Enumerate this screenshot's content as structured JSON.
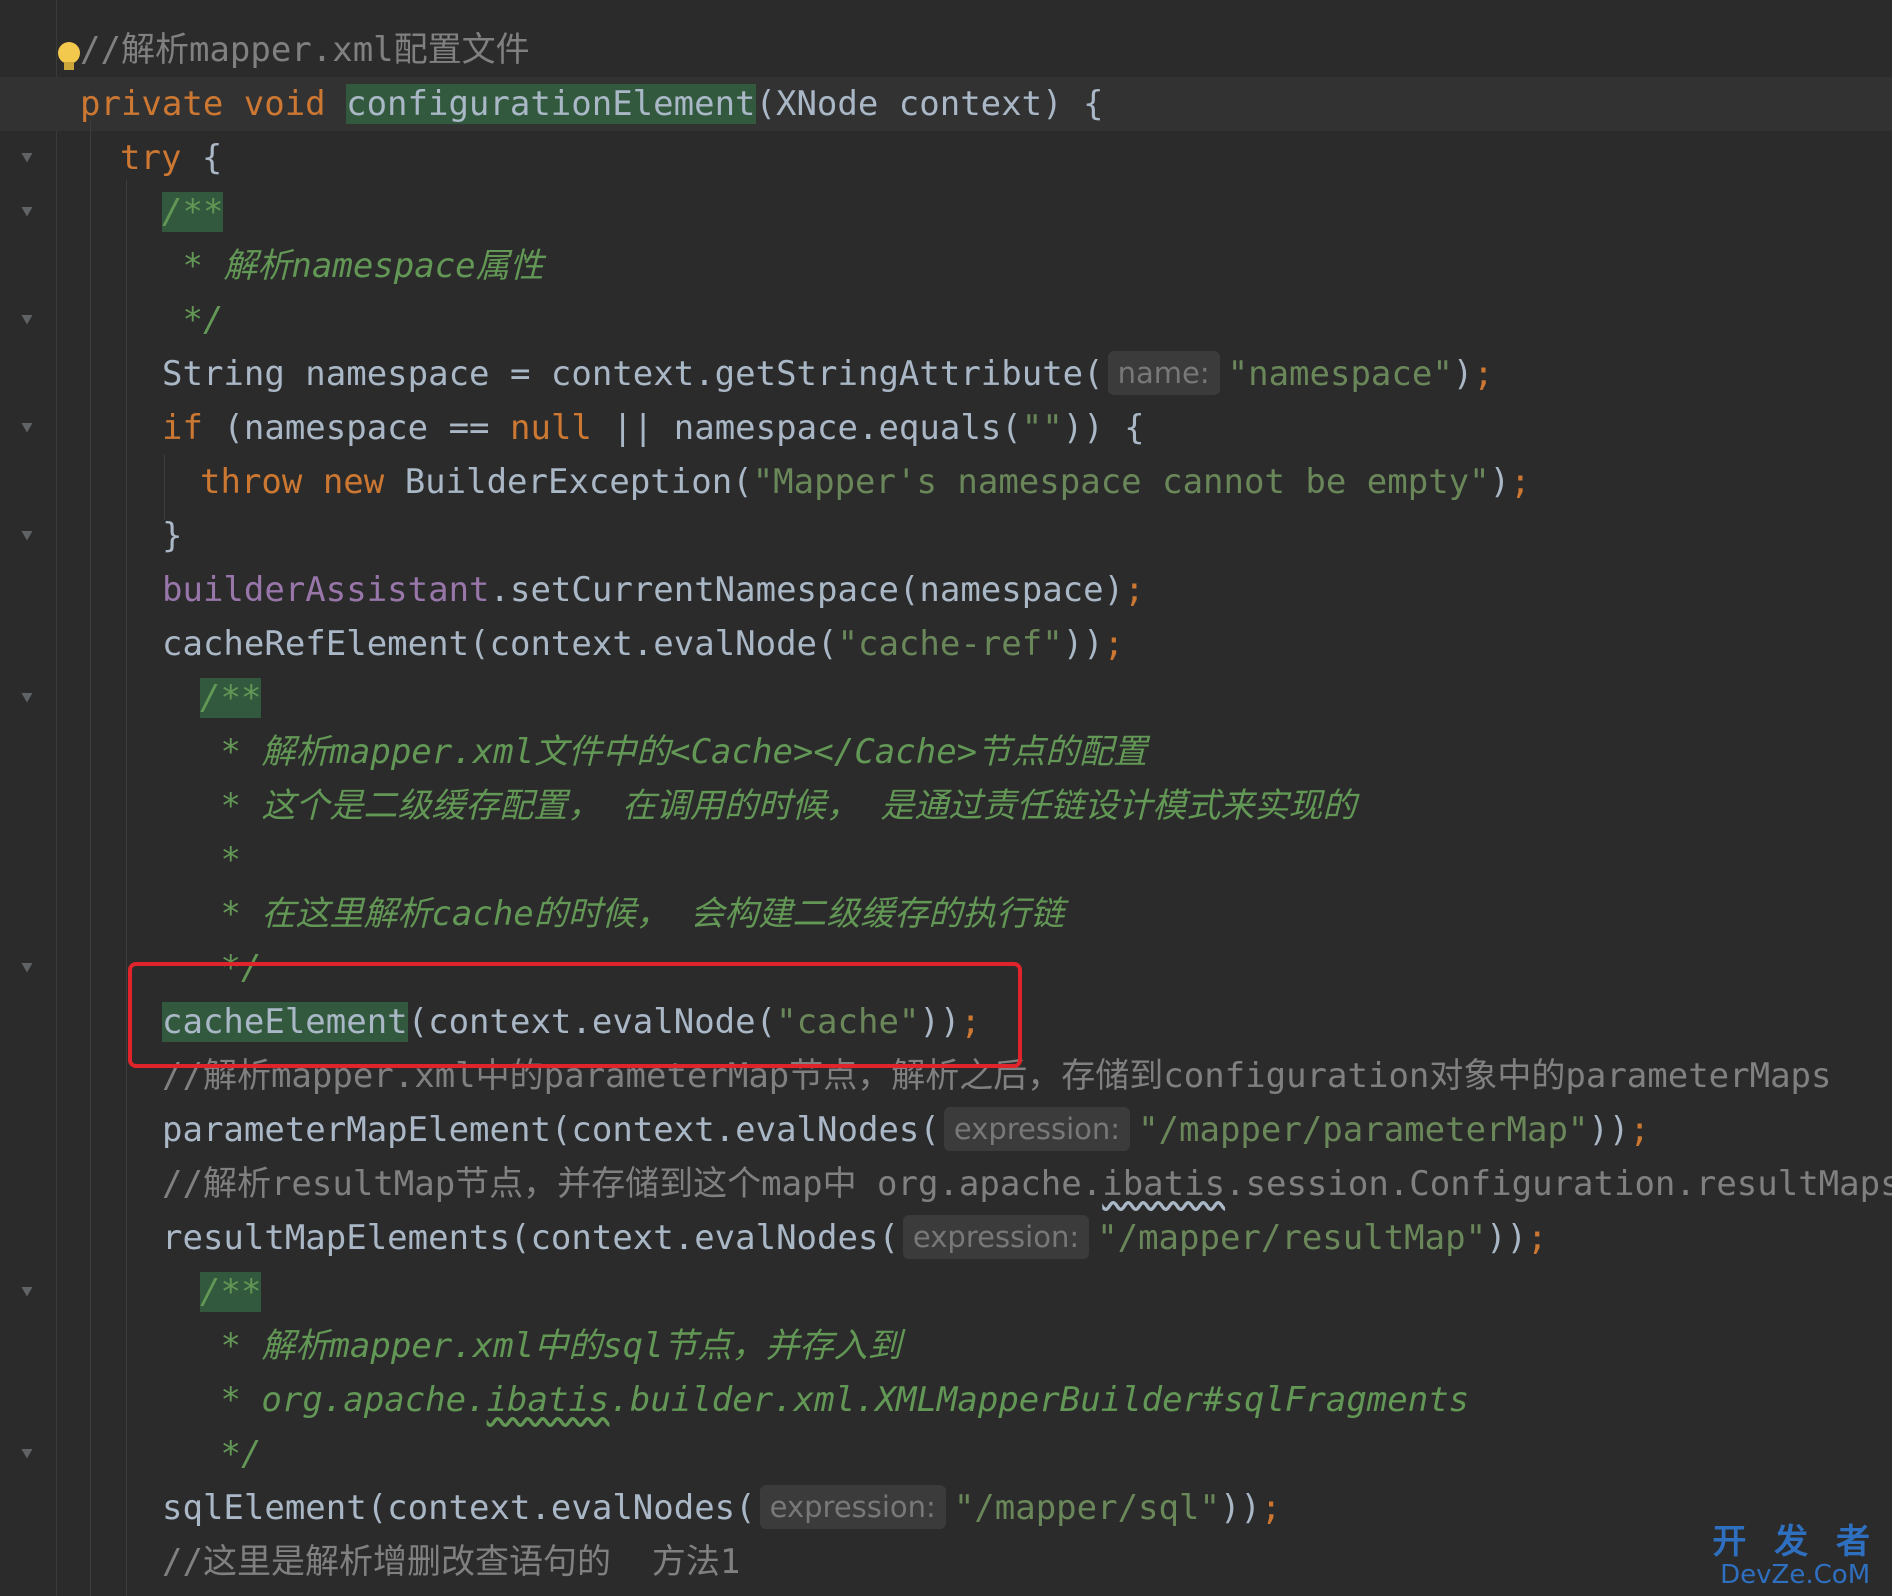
{
  "editor": {
    "code_lines": [
      {
        "tokens": [
          {
            "t": "//解析mapper.xml配置文件",
            "c": "cmt"
          }
        ]
      },
      {
        "tokens": [
          {
            "t": "private void ",
            "c": "kw"
          },
          {
            "t": "configurationElement",
            "c": "hl"
          },
          {
            "t": "(XNode context) {",
            "c": "plain"
          }
        ]
      },
      {
        "tokens": [
          {
            "t": "try ",
            "c": "kw"
          },
          {
            "t": "{",
            "c": "plain"
          }
        ]
      },
      {
        "tokens": [
          {
            "t": "/**",
            "c": "doc hl"
          }
        ]
      },
      {
        "tokens": [
          {
            "t": " * 解析namespace属性",
            "c": "doc"
          }
        ]
      },
      {
        "tokens": [
          {
            "t": " */",
            "c": "doc"
          }
        ]
      },
      {
        "tokens": [
          {
            "t": "String namespace = context.getStringAttribute(",
            "c": "plain"
          },
          {
            "t": "name:",
            "c": "hint"
          },
          {
            "t": "\"namespace\"",
            "c": "str"
          },
          {
            "t": ")",
            "c": "plain"
          },
          {
            "t": ";",
            "c": "kw"
          }
        ]
      },
      {
        "tokens": [
          {
            "t": "if ",
            "c": "kw"
          },
          {
            "t": "(namespace == ",
            "c": "plain"
          },
          {
            "t": "null ",
            "c": "kw"
          },
          {
            "t": "|| namespace.equals(",
            "c": "plain"
          },
          {
            "t": "\"\"",
            "c": "str"
          },
          {
            "t": ")) {",
            "c": "plain"
          }
        ]
      },
      {
        "tokens": [
          {
            "t": "throw new ",
            "c": "kw"
          },
          {
            "t": "BuilderException(",
            "c": "plain"
          },
          {
            "t": "\"Mapper's namespace cannot be empty\"",
            "c": "str"
          },
          {
            "t": ")",
            "c": "plain"
          },
          {
            "t": ";",
            "c": "kw"
          }
        ]
      },
      {
        "tokens": [
          {
            "t": "}",
            "c": "plain"
          }
        ]
      },
      {
        "tokens": [
          {
            "t": "builderAssistant",
            "c": "field"
          },
          {
            "t": ".setCurrentNamespace(namespace)",
            "c": "plain"
          },
          {
            "t": ";",
            "c": "kw"
          }
        ]
      },
      {
        "tokens": [
          {
            "t": "cacheRefElement(context.evalNode(",
            "c": "plain"
          },
          {
            "t": "\"cache-ref\"",
            "c": "str"
          },
          {
            "t": "))",
            "c": "plain"
          },
          {
            "t": ";",
            "c": "kw"
          }
        ]
      },
      {
        "tokens": [
          {
            "t": "/**",
            "c": "doc hl"
          }
        ]
      },
      {
        "tokens": [
          {
            "t": " * 解析mapper.xml文件中的<Cache></Cache>节点的配置",
            "c": "doc"
          }
        ]
      },
      {
        "tokens": [
          {
            "t": " * 这个是二级缓存配置， 在调用的时候， 是通过责任链设计模式来实现的",
            "c": "doc"
          }
        ]
      },
      {
        "tokens": [
          {
            "t": " *",
            "c": "doc"
          }
        ]
      },
      {
        "tokens": [
          {
            "t": " * 在这里解析cache的时候， 会构建二级缓存的执行链",
            "c": "doc"
          }
        ]
      },
      {
        "tokens": [
          {
            "t": " */",
            "c": "doc"
          }
        ]
      },
      {
        "tokens": [
          {
            "t": "cacheElement",
            "c": "hl"
          },
          {
            "t": "(context.evalNode(",
            "c": "plain"
          },
          {
            "t": "\"cache\"",
            "c": "str"
          },
          {
            "t": "))",
            "c": "plain"
          },
          {
            "t": ";",
            "c": "kw"
          }
        ]
      },
      {
        "tokens": [
          {
            "t": "//解析mapper.xml中的parameterMap节点，解析之后，存储到configuration对象中的parameterMaps",
            "c": "cmt"
          }
        ]
      },
      {
        "tokens": [
          {
            "t": "parameterMapElement(context.evalNodes(",
            "c": "plain"
          },
          {
            "t": "expression:",
            "c": "hint"
          },
          {
            "t": "\"/mapper/parameterMap\"",
            "c": "str"
          },
          {
            "t": "))",
            "c": "plain"
          },
          {
            "t": ";",
            "c": "kw"
          }
        ]
      },
      {
        "tokens": [
          {
            "t": "//解析resultMap节点，并存储到这个map中 org.apache.",
            "c": "cmt"
          },
          {
            "t": "ibatis",
            "c": "cmt squiggle-plain"
          },
          {
            "t": ".session.Configuration.resultMaps",
            "c": "cmt"
          }
        ]
      },
      {
        "tokens": [
          {
            "t": "resultMapElements(context.evalNodes(",
            "c": "plain"
          },
          {
            "t": "expression:",
            "c": "hint"
          },
          {
            "t": "\"/mapper/resultMap\"",
            "c": "str"
          },
          {
            "t": "))",
            "c": "plain"
          },
          {
            "t": ";",
            "c": "kw"
          }
        ]
      },
      {
        "tokens": [
          {
            "t": "/**",
            "c": "doc hl"
          }
        ]
      },
      {
        "tokens": [
          {
            "t": " * 解析mapper.xml中的sql节点，并存入到",
            "c": "doc"
          }
        ]
      },
      {
        "tokens": [
          {
            "t": " * org.apache.",
            "c": "doc"
          },
          {
            "t": "ibatis",
            "c": "doc squiggle"
          },
          {
            "t": ".builder.xml.XMLMapperBuilder#sqlFragments",
            "c": "doc"
          }
        ]
      },
      {
        "tokens": [
          {
            "t": " */",
            "c": "doc"
          }
        ]
      },
      {
        "tokens": [
          {
            "t": "sqlElement(context.evalNodes(",
            "c": "plain"
          },
          {
            "t": "expression:",
            "c": "hint"
          },
          {
            "t": "\"/mapper/sql\"",
            "c": "str"
          },
          {
            "t": "))",
            "c": "plain"
          },
          {
            "t": ";",
            "c": "kw"
          }
        ]
      },
      {
        "tokens": [
          {
            "t": "//这里是解析增删改查语句的  方法1",
            "c": "cmt"
          }
        ]
      }
    ]
  },
  "colors": {
    "background": "#2b2b2b",
    "keyword": "#cc7832",
    "string": "#6a8759",
    "doc_comment": "#629755",
    "line_comment": "#808080",
    "field": "#9876aa",
    "method_highlight_bg": "#32593d",
    "annotation_box": "#e0242b"
  },
  "icons": {
    "gutter_icon": "fold-marker-icon",
    "bulb_icon": "lightbulb-icon"
  },
  "watermark": {
    "top": "开 发 者",
    "bottom": "DevZe.CoM"
  }
}
